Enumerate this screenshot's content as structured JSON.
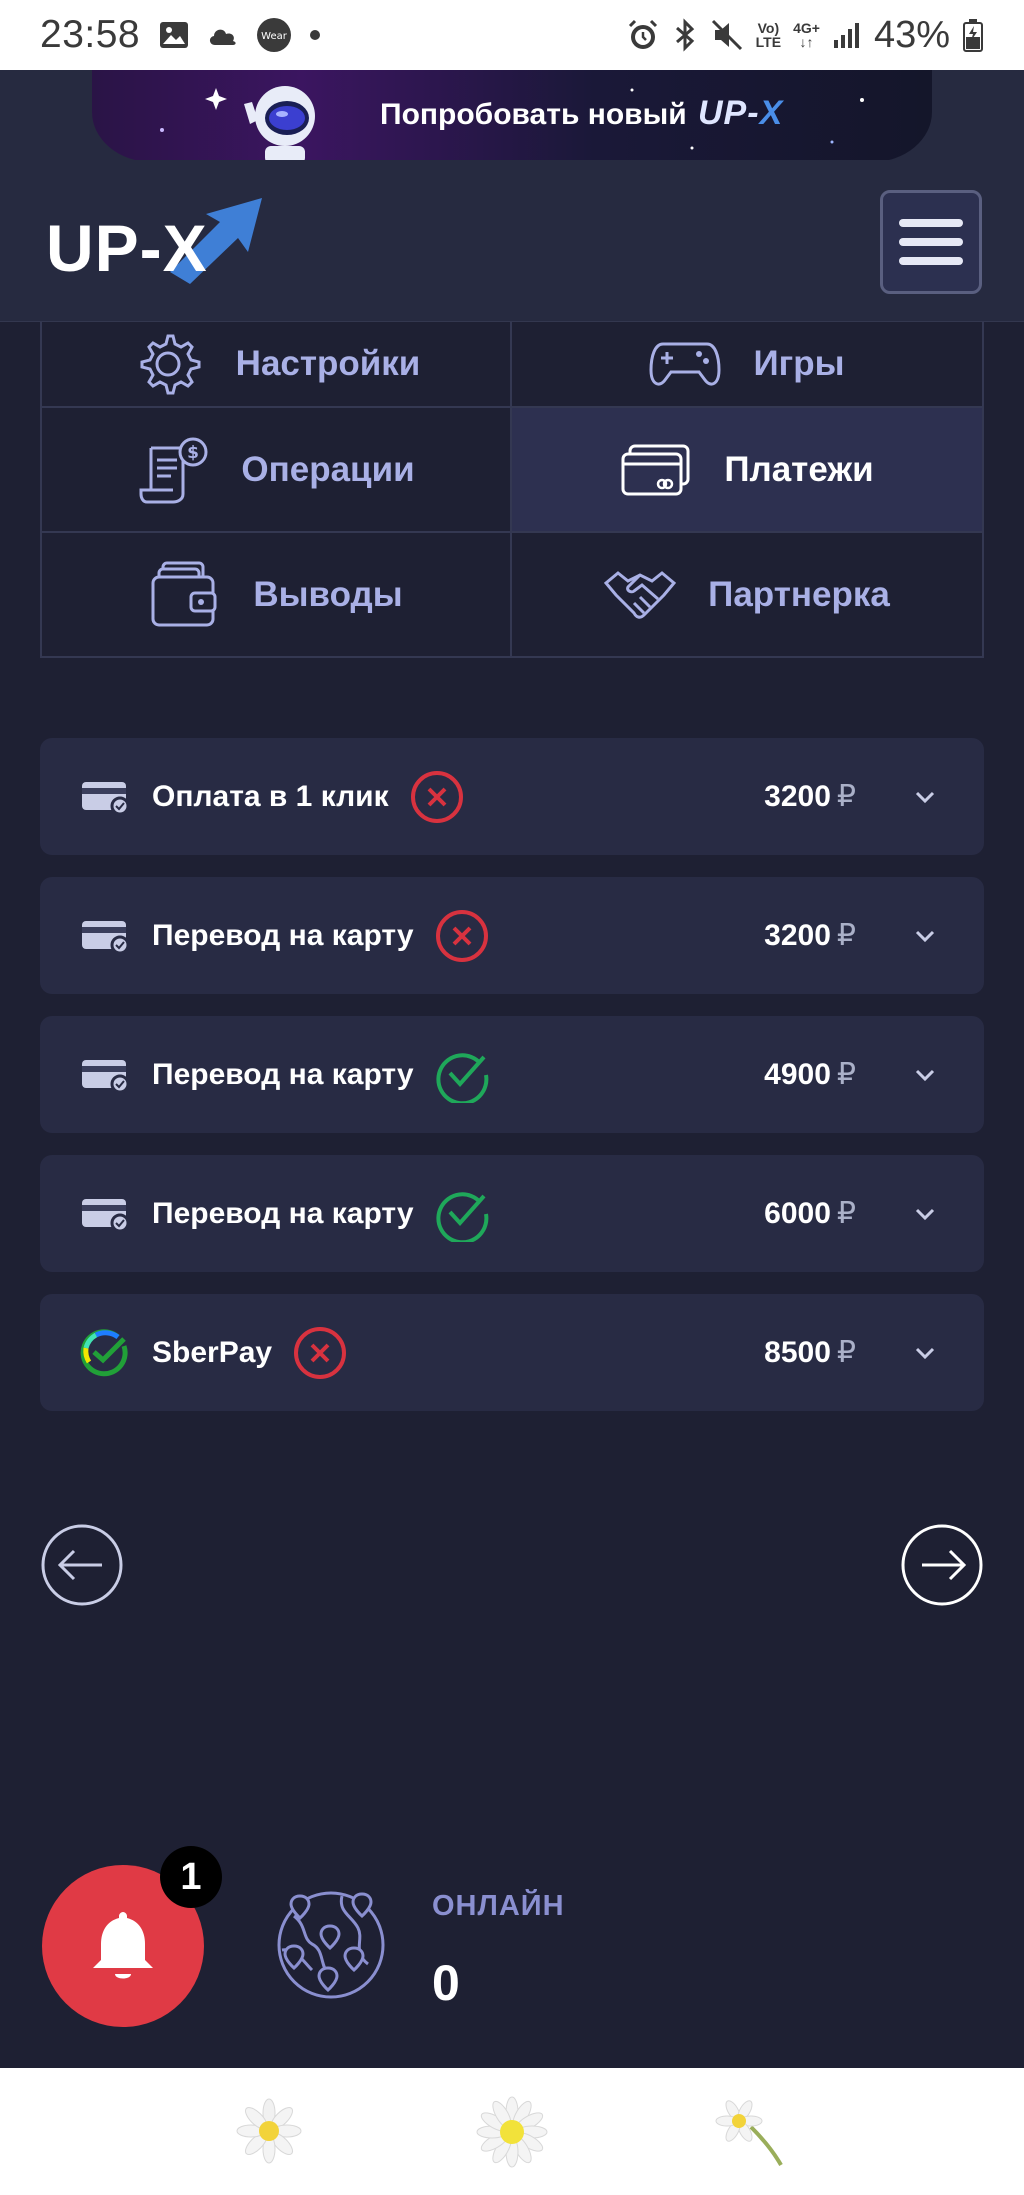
{
  "status_bar": {
    "time": "23:58",
    "battery": "43%",
    "network_top": "Vo)",
    "network_bottom": "LTE",
    "gen_top": "4G+",
    "wear_label": "Wear"
  },
  "promo": {
    "text": "Попробовать новый",
    "logo_main": "UP-",
    "logo_x": "X"
  },
  "header": {
    "logo": "UP-X"
  },
  "menu": [
    {
      "label": "Настройки",
      "icon": "gear-icon",
      "active": false
    },
    {
      "label": "Игры",
      "icon": "gamepad-icon",
      "active": false
    },
    {
      "label": "Операции",
      "icon": "receipt-icon",
      "active": false
    },
    {
      "label": "Платежи",
      "icon": "cards-icon",
      "active": true
    },
    {
      "label": "Выводы",
      "icon": "wallet-icon",
      "active": false
    },
    {
      "label": "Партнерка",
      "icon": "handshake-icon",
      "active": false
    }
  ],
  "payments": [
    {
      "method": "Оплата в 1 клик",
      "status": "failed",
      "amount": "3200",
      "currency": "₽",
      "icon": "card-icon"
    },
    {
      "method": "Перевод на карту",
      "status": "failed",
      "amount": "3200",
      "currency": "₽",
      "icon": "card-icon"
    },
    {
      "method": "Перевод на карту",
      "status": "success",
      "amount": "4900",
      "currency": "₽",
      "icon": "card-icon"
    },
    {
      "method": "Перевод на карту",
      "status": "success",
      "amount": "6000",
      "currency": "₽",
      "icon": "card-icon"
    },
    {
      "method": "SberPay",
      "status": "failed",
      "amount": "8500",
      "currency": "₽",
      "icon": "sberpay-icon"
    }
  ],
  "notifications": {
    "badge": "1"
  },
  "online": {
    "label": "ОНЛАЙН",
    "count": "0"
  },
  "colors": {
    "background": "#1e2033",
    "header": "#262a40",
    "row": "#282b44",
    "accent": "#a9b0e6",
    "success": "#1fa85a",
    "error": "#d8323f",
    "bell": "#e03a45"
  }
}
